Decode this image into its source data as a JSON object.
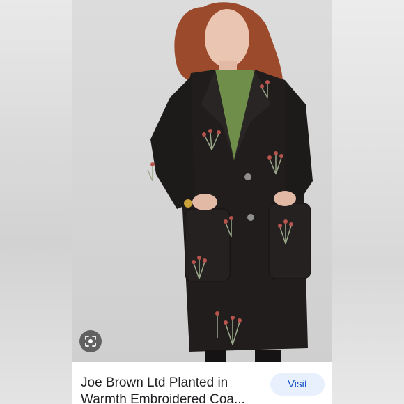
{
  "result_card": {
    "title_line_1": "Joe Brown Ltd Planted in",
    "title_line_2": "Warmth Embroidered Coa...",
    "visit_label": "Visit",
    "lens_icon": "lens-icon"
  },
  "colors": {
    "visit_bg": "#e8f0fe",
    "visit_text": "#1a56c8",
    "coat": "#1f1c1c",
    "blouse": "#6f8f4c",
    "hair": "#a0472a"
  }
}
